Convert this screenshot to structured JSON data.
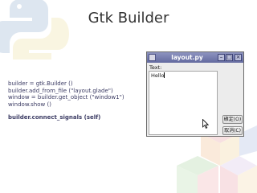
{
  "slide": {
    "title": "Gtk Builder",
    "code_lines": [
      "builder = gtk.Builder ()",
      "builder.add_from_file (\"layout.glade\")",
      "window = builder.get_object (\"window1\")",
      "window.show ()"
    ],
    "code_emphasis": "builder.connect_signals (self)"
  },
  "window": {
    "title": "layout.py",
    "label": "Text:",
    "textview_value": "Hello",
    "buttons": {
      "ok": "確定(O)",
      "cancel": "取消(C)"
    },
    "titlebar_buttons": {
      "minimize": "–",
      "maximize": "□",
      "close": "×"
    }
  },
  "colors": {
    "title_text": "#333333",
    "code_text": "#3b3b63",
    "titlebar": "#7479ad",
    "window_bg": "#ececec"
  },
  "icons": [
    "python-logo",
    "window-app-icon",
    "minimize-icon",
    "maximize-icon",
    "close-icon",
    "mouse-pointer-icon",
    "cubes-decoration"
  ]
}
